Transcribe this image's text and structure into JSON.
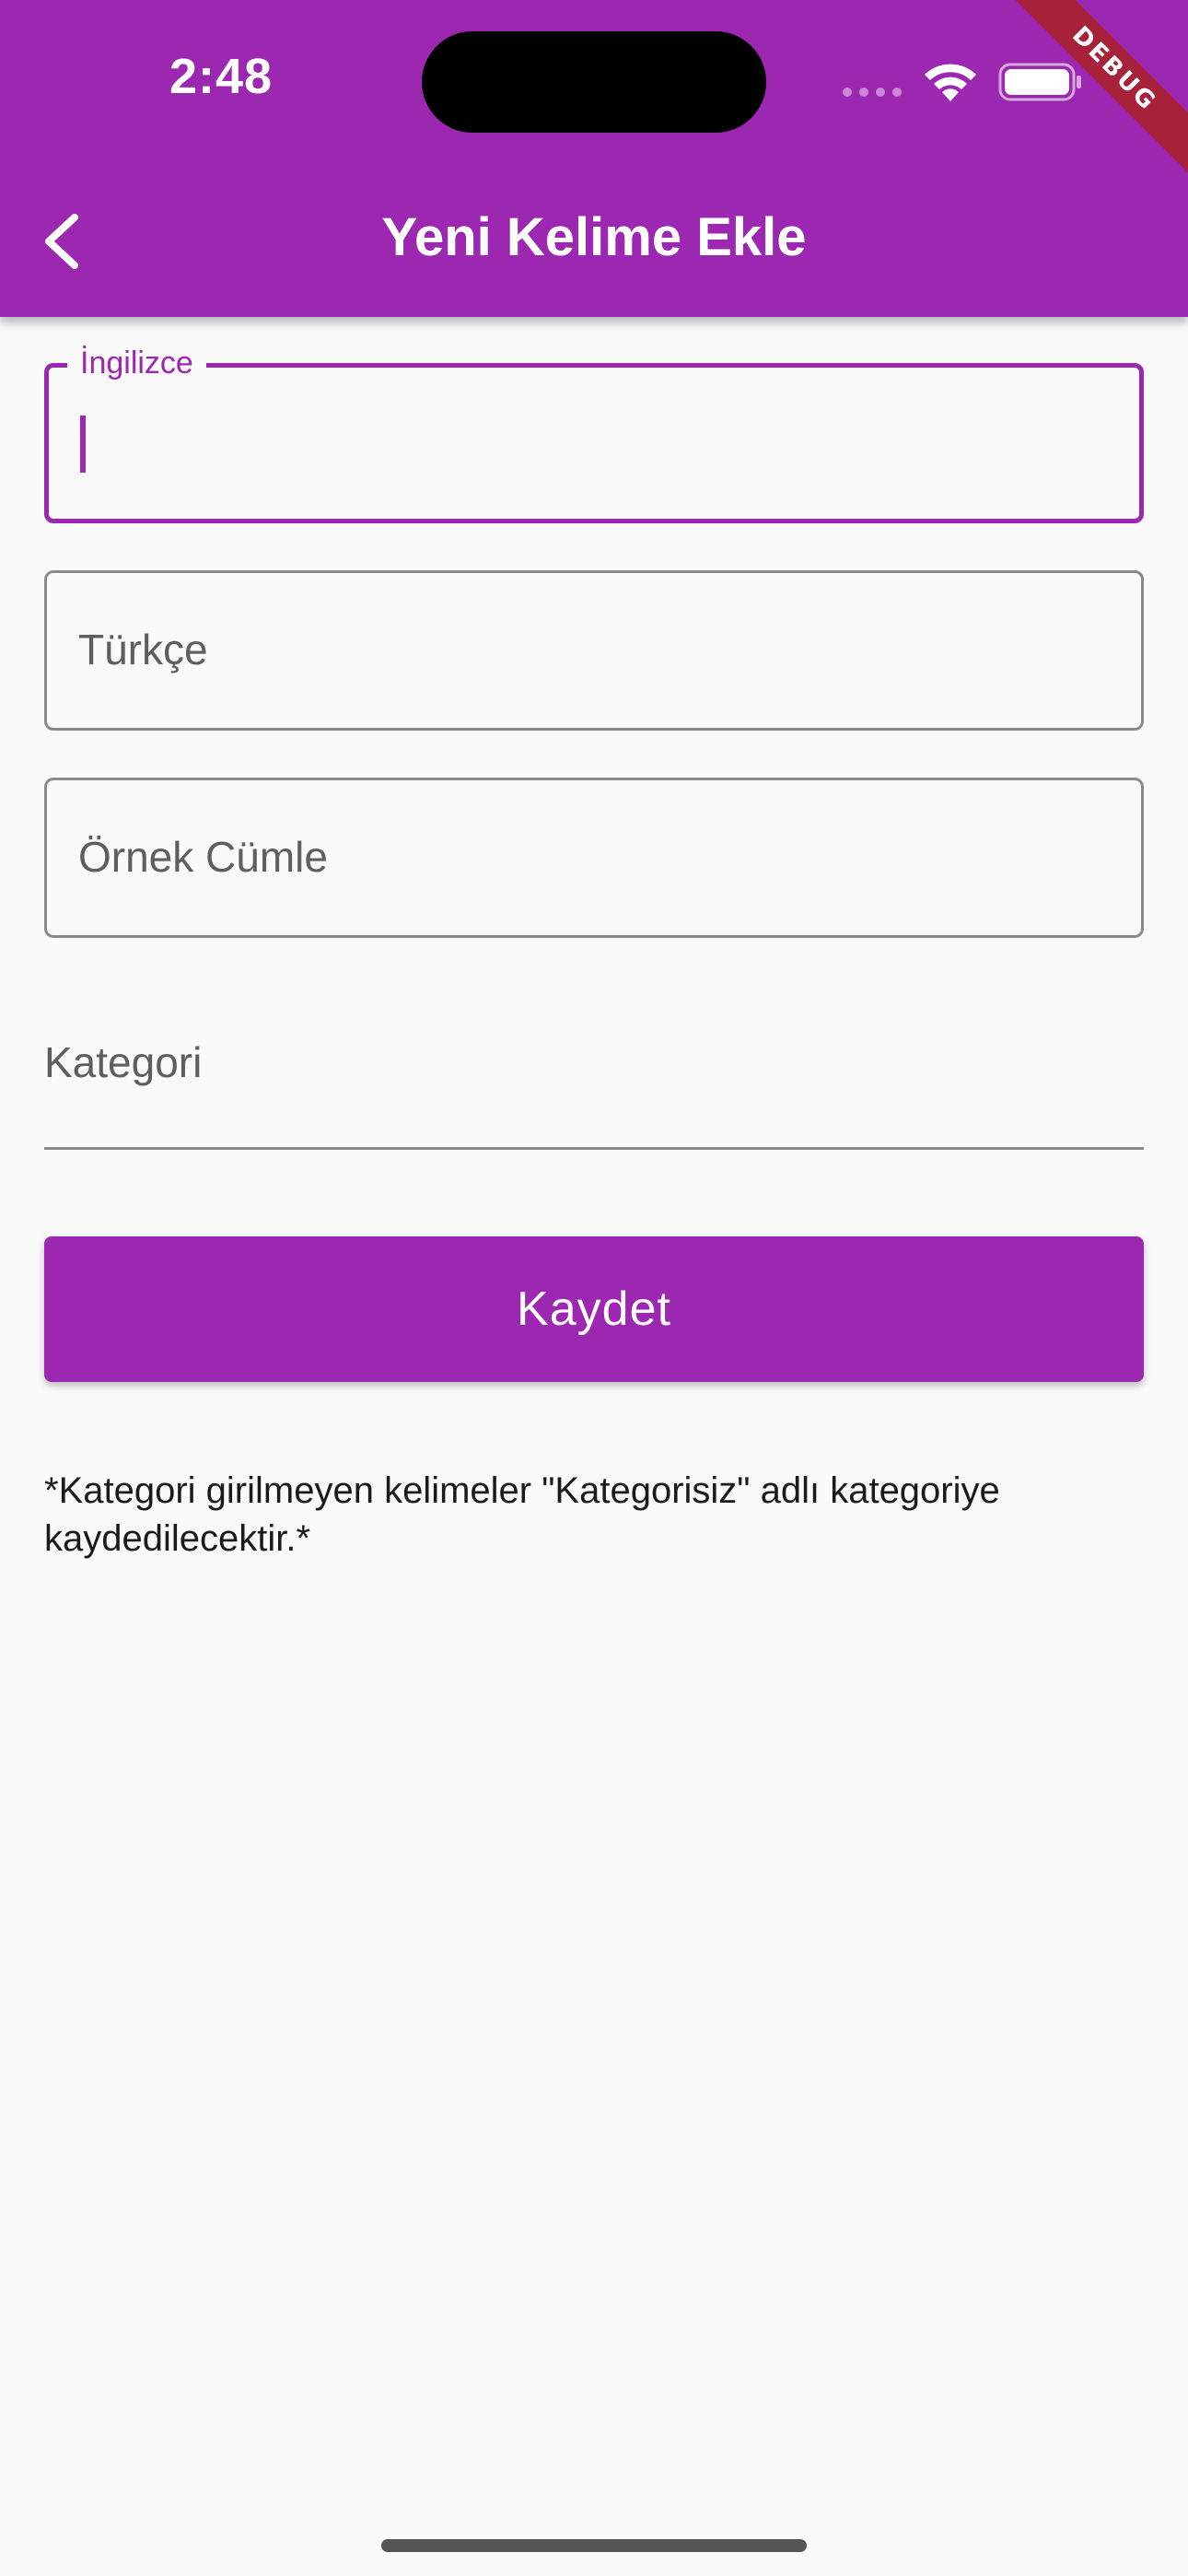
{
  "status_bar": {
    "time": "2:48",
    "debug_label": "DEBUG"
  },
  "appbar": {
    "title": "Yeni Kelime Ekle",
    "back_icon": "chevron-left-icon",
    "background_color": "#9c27b0"
  },
  "form": {
    "english": {
      "label": "İngilizce",
      "value": ""
    },
    "turkish": {
      "placeholder": "Türkçe",
      "value": ""
    },
    "example_sentence": {
      "placeholder": "Örnek Cümle",
      "value": ""
    },
    "category": {
      "placeholder": "Kategori",
      "value": ""
    },
    "save_label": "Kaydet"
  },
  "note": "*Kategori girilmeyen kelimeler \"Kategorisiz\" adlı kategoriye kaydedilecektir.*",
  "colors": {
    "accent": "#9c27b0",
    "background": "#fafafa",
    "debug_ribbon": "#a8213a"
  }
}
